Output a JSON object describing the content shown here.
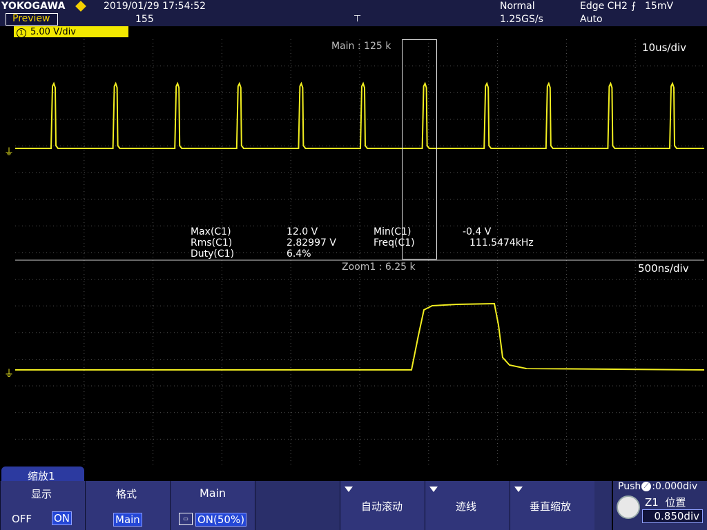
{
  "header": {
    "brand": "YOKOGAWA",
    "preview": "Preview",
    "datetime": "2019/01/29  17:54:52",
    "acq_count": "155",
    "mode": "Normal",
    "sample_rate": "1.25GS/s",
    "trigger": "Edge CH2",
    "trigger_level": "15mV",
    "trigger_mode": "Auto"
  },
  "channel1": {
    "number": "1",
    "scale": "5.00 V/div"
  },
  "main_window": {
    "label": "Main : 125 k",
    "timebase": "10us/div"
  },
  "zoom_window": {
    "label": "Zoom1 : 6.25 k",
    "timebase": "500ns/div"
  },
  "measurements": [
    {
      "name": "Max(C1)",
      "value": "12.0 V"
    },
    {
      "name": "Min(C1)",
      "value": "-0.4 V"
    },
    {
      "name": "Rms(C1)",
      "value": "2.82997 V"
    },
    {
      "name": "Freq(C1)",
      "value": "111.5474kHz"
    },
    {
      "name": "Duty(C1)",
      "value": "6.4%"
    }
  ],
  "softkeys": {
    "tab": "缩放1",
    "display": {
      "title": "显示",
      "off": "OFF",
      "on": "ON"
    },
    "format": {
      "title": "格式",
      "value": "Main"
    },
    "main": {
      "title": "Main",
      "value": "ON(50%)"
    },
    "auto_scroll": "自动滚动",
    "trace": "迹线",
    "vzoom": "垂直缩放"
  },
  "knob": {
    "push": "Push",
    "push_value": ":0.000div",
    "param_z": "Z1",
    "param_name": "位置",
    "value": "0.850div"
  },
  "colors": {
    "trace": "#f2ee20",
    "header": "#1a1c44",
    "softkey": "#30357a",
    "grid": "#5a5a5a"
  }
}
